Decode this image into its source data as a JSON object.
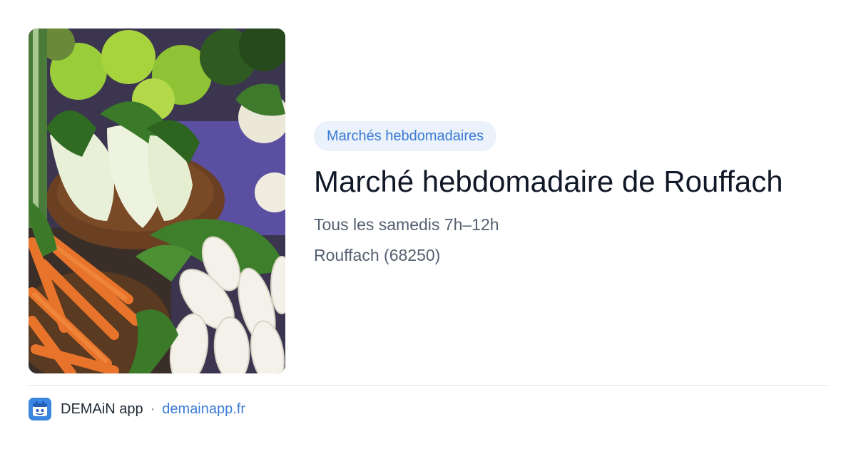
{
  "card": {
    "image": {
      "description_icon": "vegetables-photo"
    },
    "category": "Marchés hebdomadaires",
    "title": "Marché hebdomadaire de Rouffach",
    "schedule": "Tous les samedis 7h–12h",
    "location": "Rouffach (68250)"
  },
  "footer": {
    "brand": "DEMAiN app",
    "separator": "·",
    "url": "demainapp.fr",
    "logo_icon": "demain-app-logo-icon"
  },
  "colors": {
    "accent": "#3a7bd5",
    "chip_bg": "#ebf2fc",
    "title": "#111827",
    "muted": "#556070"
  }
}
